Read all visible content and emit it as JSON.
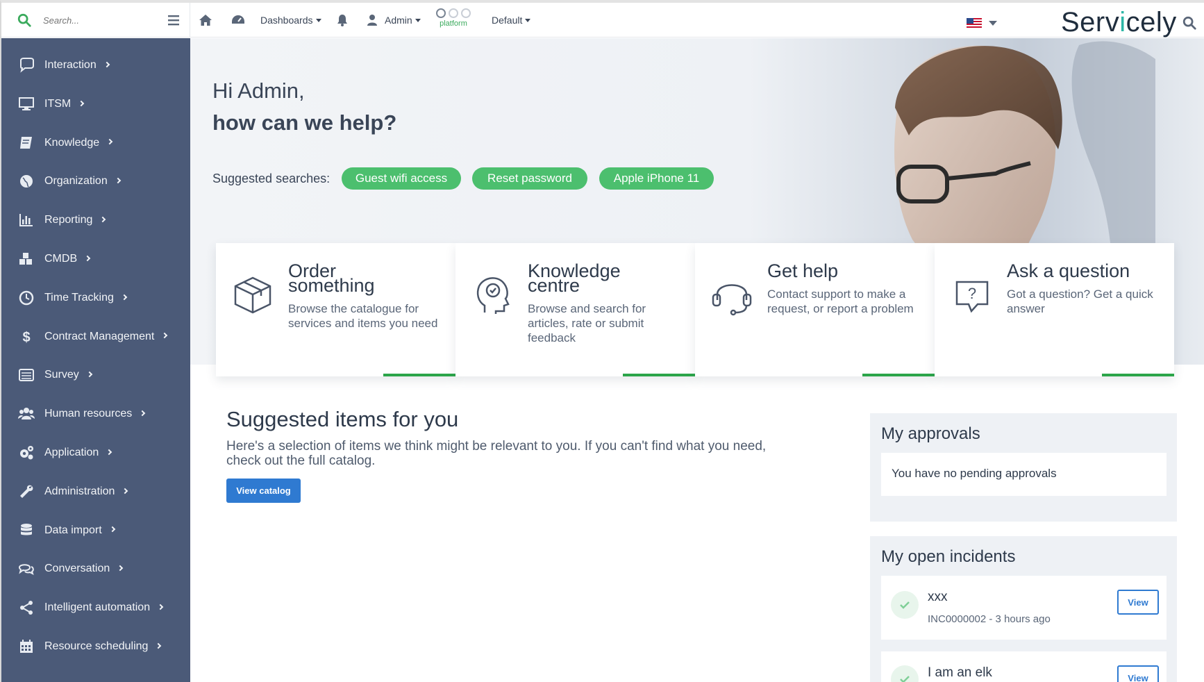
{
  "topbar": {
    "search_placeholder": "Search...",
    "dashboards": "Dashboards",
    "user": "Admin",
    "platform_label": "platform",
    "default": "Default",
    "brand_pre": "Serv",
    "brand_i": "i",
    "brand_post": "cely"
  },
  "sidebar": {
    "items": [
      {
        "label": "Interaction",
        "icon": "chat-bubble-icon"
      },
      {
        "label": "ITSM",
        "icon": "monitor-icon"
      },
      {
        "label": "Knowledge",
        "icon": "book-icon"
      },
      {
        "label": "Organization",
        "icon": "globe-icon"
      },
      {
        "label": "Reporting",
        "icon": "bar-chart-icon"
      },
      {
        "label": "CMDB",
        "icon": "cubes-icon"
      },
      {
        "label": "Time Tracking",
        "icon": "clock-icon"
      },
      {
        "label": "Contract Management",
        "icon": "dollar-icon"
      },
      {
        "label": "Survey",
        "icon": "list-icon"
      },
      {
        "label": "Human resources",
        "icon": "users-icon"
      },
      {
        "label": "Application",
        "icon": "gears-icon"
      },
      {
        "label": "Administration",
        "icon": "wrench-icon"
      },
      {
        "label": "Data import",
        "icon": "database-icon"
      },
      {
        "label": "Conversation",
        "icon": "comments-icon"
      },
      {
        "label": "Intelligent automation",
        "icon": "share-icon"
      },
      {
        "label": "Resource scheduling",
        "icon": "calendar-icon"
      }
    ]
  },
  "hero": {
    "greeting": "Hi Admin,",
    "question": "how can we help?",
    "suggested_label": "Suggested searches:",
    "chips": [
      "Guest wifi access",
      "Reset password",
      "Apple iPhone 11"
    ]
  },
  "cards": [
    {
      "title_l1": "Order",
      "title_l2": "something",
      "desc": "Browse the catalogue for services and items you need",
      "icon": "box-icon"
    },
    {
      "title_l1": "Knowledge",
      "title_l2": "centre",
      "desc": "Browse and search for articles, rate or submit feedback",
      "icon": "head-check-icon"
    },
    {
      "title_l1": "Get help",
      "title_l2": "",
      "desc": "Contact support to make a request, or report a problem",
      "icon": "headset-icon"
    },
    {
      "title_l1": "Ask a question",
      "title_l2": "",
      "desc": "Got a question? Get a quick answer",
      "icon": "question-bubble-icon"
    }
  ],
  "suggested": {
    "title": "Suggested items for you",
    "desc": "Here's a selection of items we think might be relevant to you. If you can't find what you need, check out the full catalog.",
    "button": "View catalog"
  },
  "approvals": {
    "title": "My approvals",
    "empty": "You have no pending approvals"
  },
  "incidents": {
    "title": "My open incidents",
    "items": [
      {
        "name": "xxx",
        "sub": "INC0000002 - 3 hours ago",
        "button": "View"
      },
      {
        "name": "I am an elk",
        "sub": "",
        "button": "View"
      }
    ]
  },
  "colors": {
    "sidebar": "#4b5a78",
    "chip": "#4cbf6e",
    "accent": "#2f7ad1",
    "card_bar": "#2ca54a"
  }
}
